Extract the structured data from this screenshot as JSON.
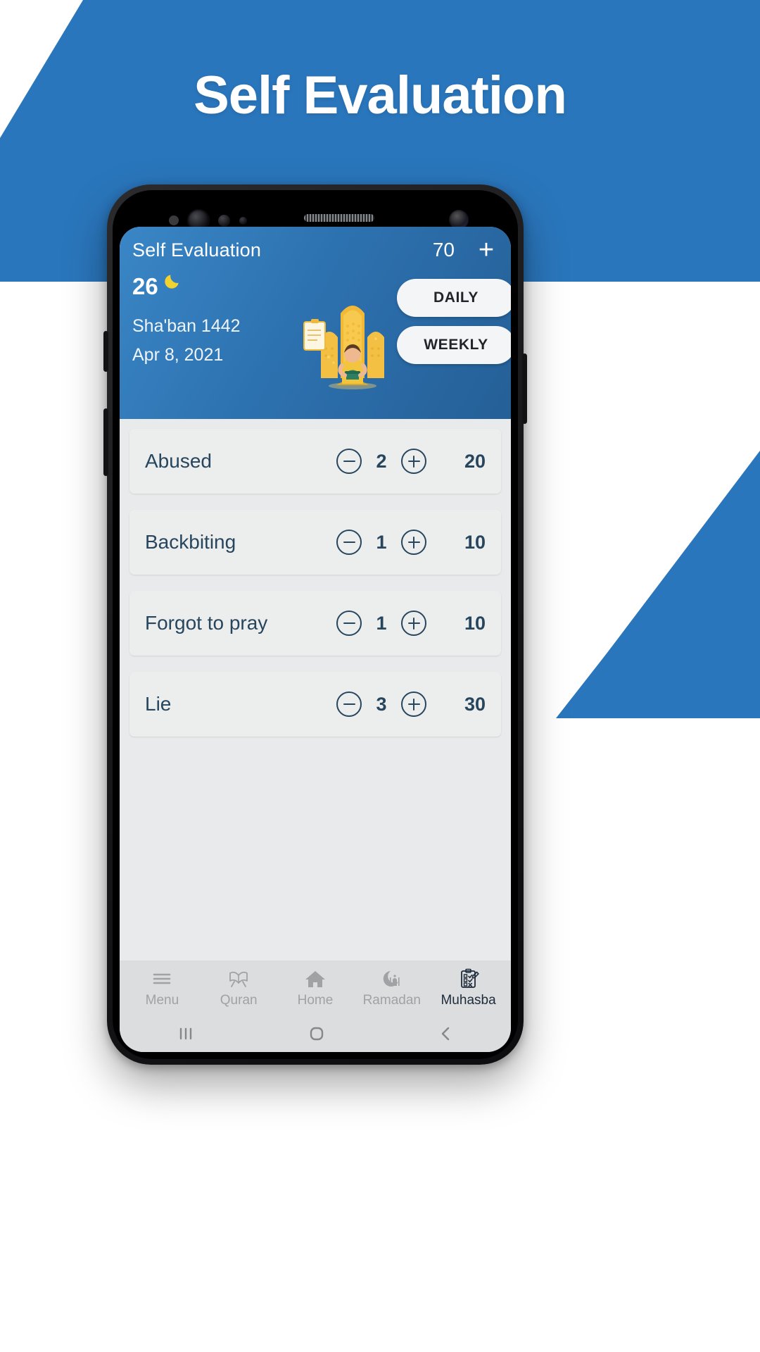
{
  "banner": {
    "title": "Self Evaluation",
    "bg_color": "#2a76bc",
    "text_color": "#ffffff"
  },
  "app": {
    "header": {
      "title": "Self Evaluation",
      "score": "70",
      "add_label": "+",
      "accent": "#2d72b0"
    },
    "date_card": {
      "hijri_day": "26",
      "moon_icon": "crescent-moon-icon",
      "hijri_month": "Sha'ban 1442",
      "gregorian_date": "Apr 8, 2021",
      "illustration": "man-reading-quran-illustration"
    },
    "period_buttons": [
      {
        "label": "DAILY",
        "name": "daily"
      },
      {
        "label": "WEEKLY",
        "name": "weekly"
      }
    ],
    "list": {
      "decrement_icon": "minus-circle-icon",
      "increment_icon": "plus-circle-icon",
      "rows": [
        {
          "label": "Abused",
          "count": "2",
          "points": "20"
        },
        {
          "label": "Backbiting",
          "count": "1",
          "points": "10"
        },
        {
          "label": "Forgot to pray",
          "count": "1",
          "points": "10"
        },
        {
          "label": "Lie",
          "count": "3",
          "points": "30"
        }
      ]
    },
    "bottom_nav": {
      "items": [
        {
          "label": "Menu",
          "icon": "hamburger-menu-icon",
          "active": false
        },
        {
          "label": "Quran",
          "icon": "open-quran-icon",
          "active": false
        },
        {
          "label": "Home",
          "icon": "home-icon",
          "active": false
        },
        {
          "label": "Ramadan",
          "icon": "mosque-crescent-icon",
          "active": false
        },
        {
          "label": "Muhasba",
          "icon": "checklist-icon",
          "active": true
        }
      ],
      "active_color": "#1d2b3a",
      "inactive_color": "#a0a2a5"
    },
    "android_nav": {
      "recents_icon": "recents-bars-icon",
      "home_icon": "home-circle-icon",
      "back_icon": "back-chevron-icon"
    }
  },
  "colors": {
    "row_text": "#27465e",
    "row_bg": "#eceded",
    "screen_bg": "#e9eaec",
    "moon_yellow": "#f2d22e"
  }
}
